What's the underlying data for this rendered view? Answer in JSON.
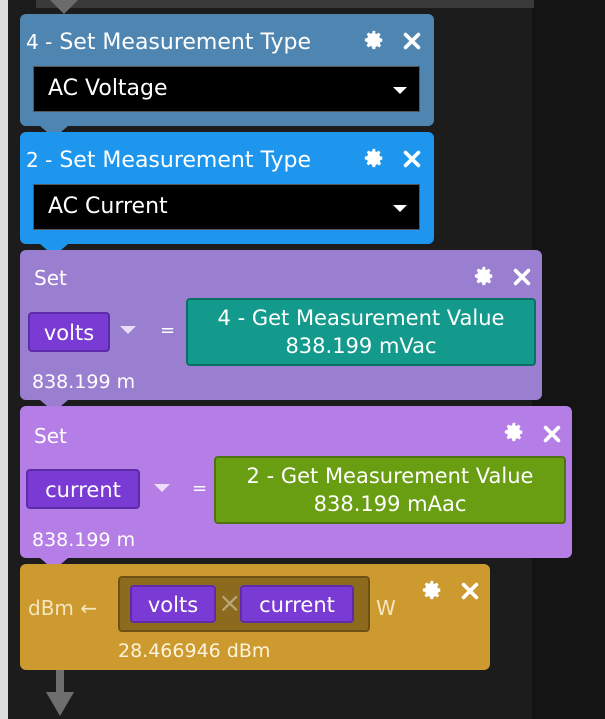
{
  "blocks": {
    "set_type_4": {
      "num": "4 -",
      "title": "Set Measurement Type",
      "selected": "AC Voltage",
      "color": "#4f86b1"
    },
    "set_type_2": {
      "num": "2 -",
      "title": "Set Measurement Type",
      "selected": "AC Current",
      "color": "#1e96ee"
    },
    "set_volts": {
      "label": "Set",
      "variable": "volts",
      "equals": "=",
      "value_title": "4 - Get Measurement Value",
      "value_reading": "838.199 mVac",
      "result": "838.199 m",
      "color": "#9a7fd0"
    },
    "set_current": {
      "label": "Set",
      "variable": "current",
      "equals": "=",
      "value_title": "2 - Get Measurement Value",
      "value_reading": "838.199 mAac",
      "result": "838.199 m",
      "color": "#b57ee6"
    },
    "dbm": {
      "label": "dBm ←",
      "left_operand": "volts",
      "operator": "×",
      "right_operand": "current",
      "unit": "W",
      "result": "28.466946 dBm",
      "color": "#cc9a2e"
    }
  },
  "icons": {
    "settings": "gear-icon",
    "remove": "close-icon",
    "flow": "down-arrow-icon"
  }
}
